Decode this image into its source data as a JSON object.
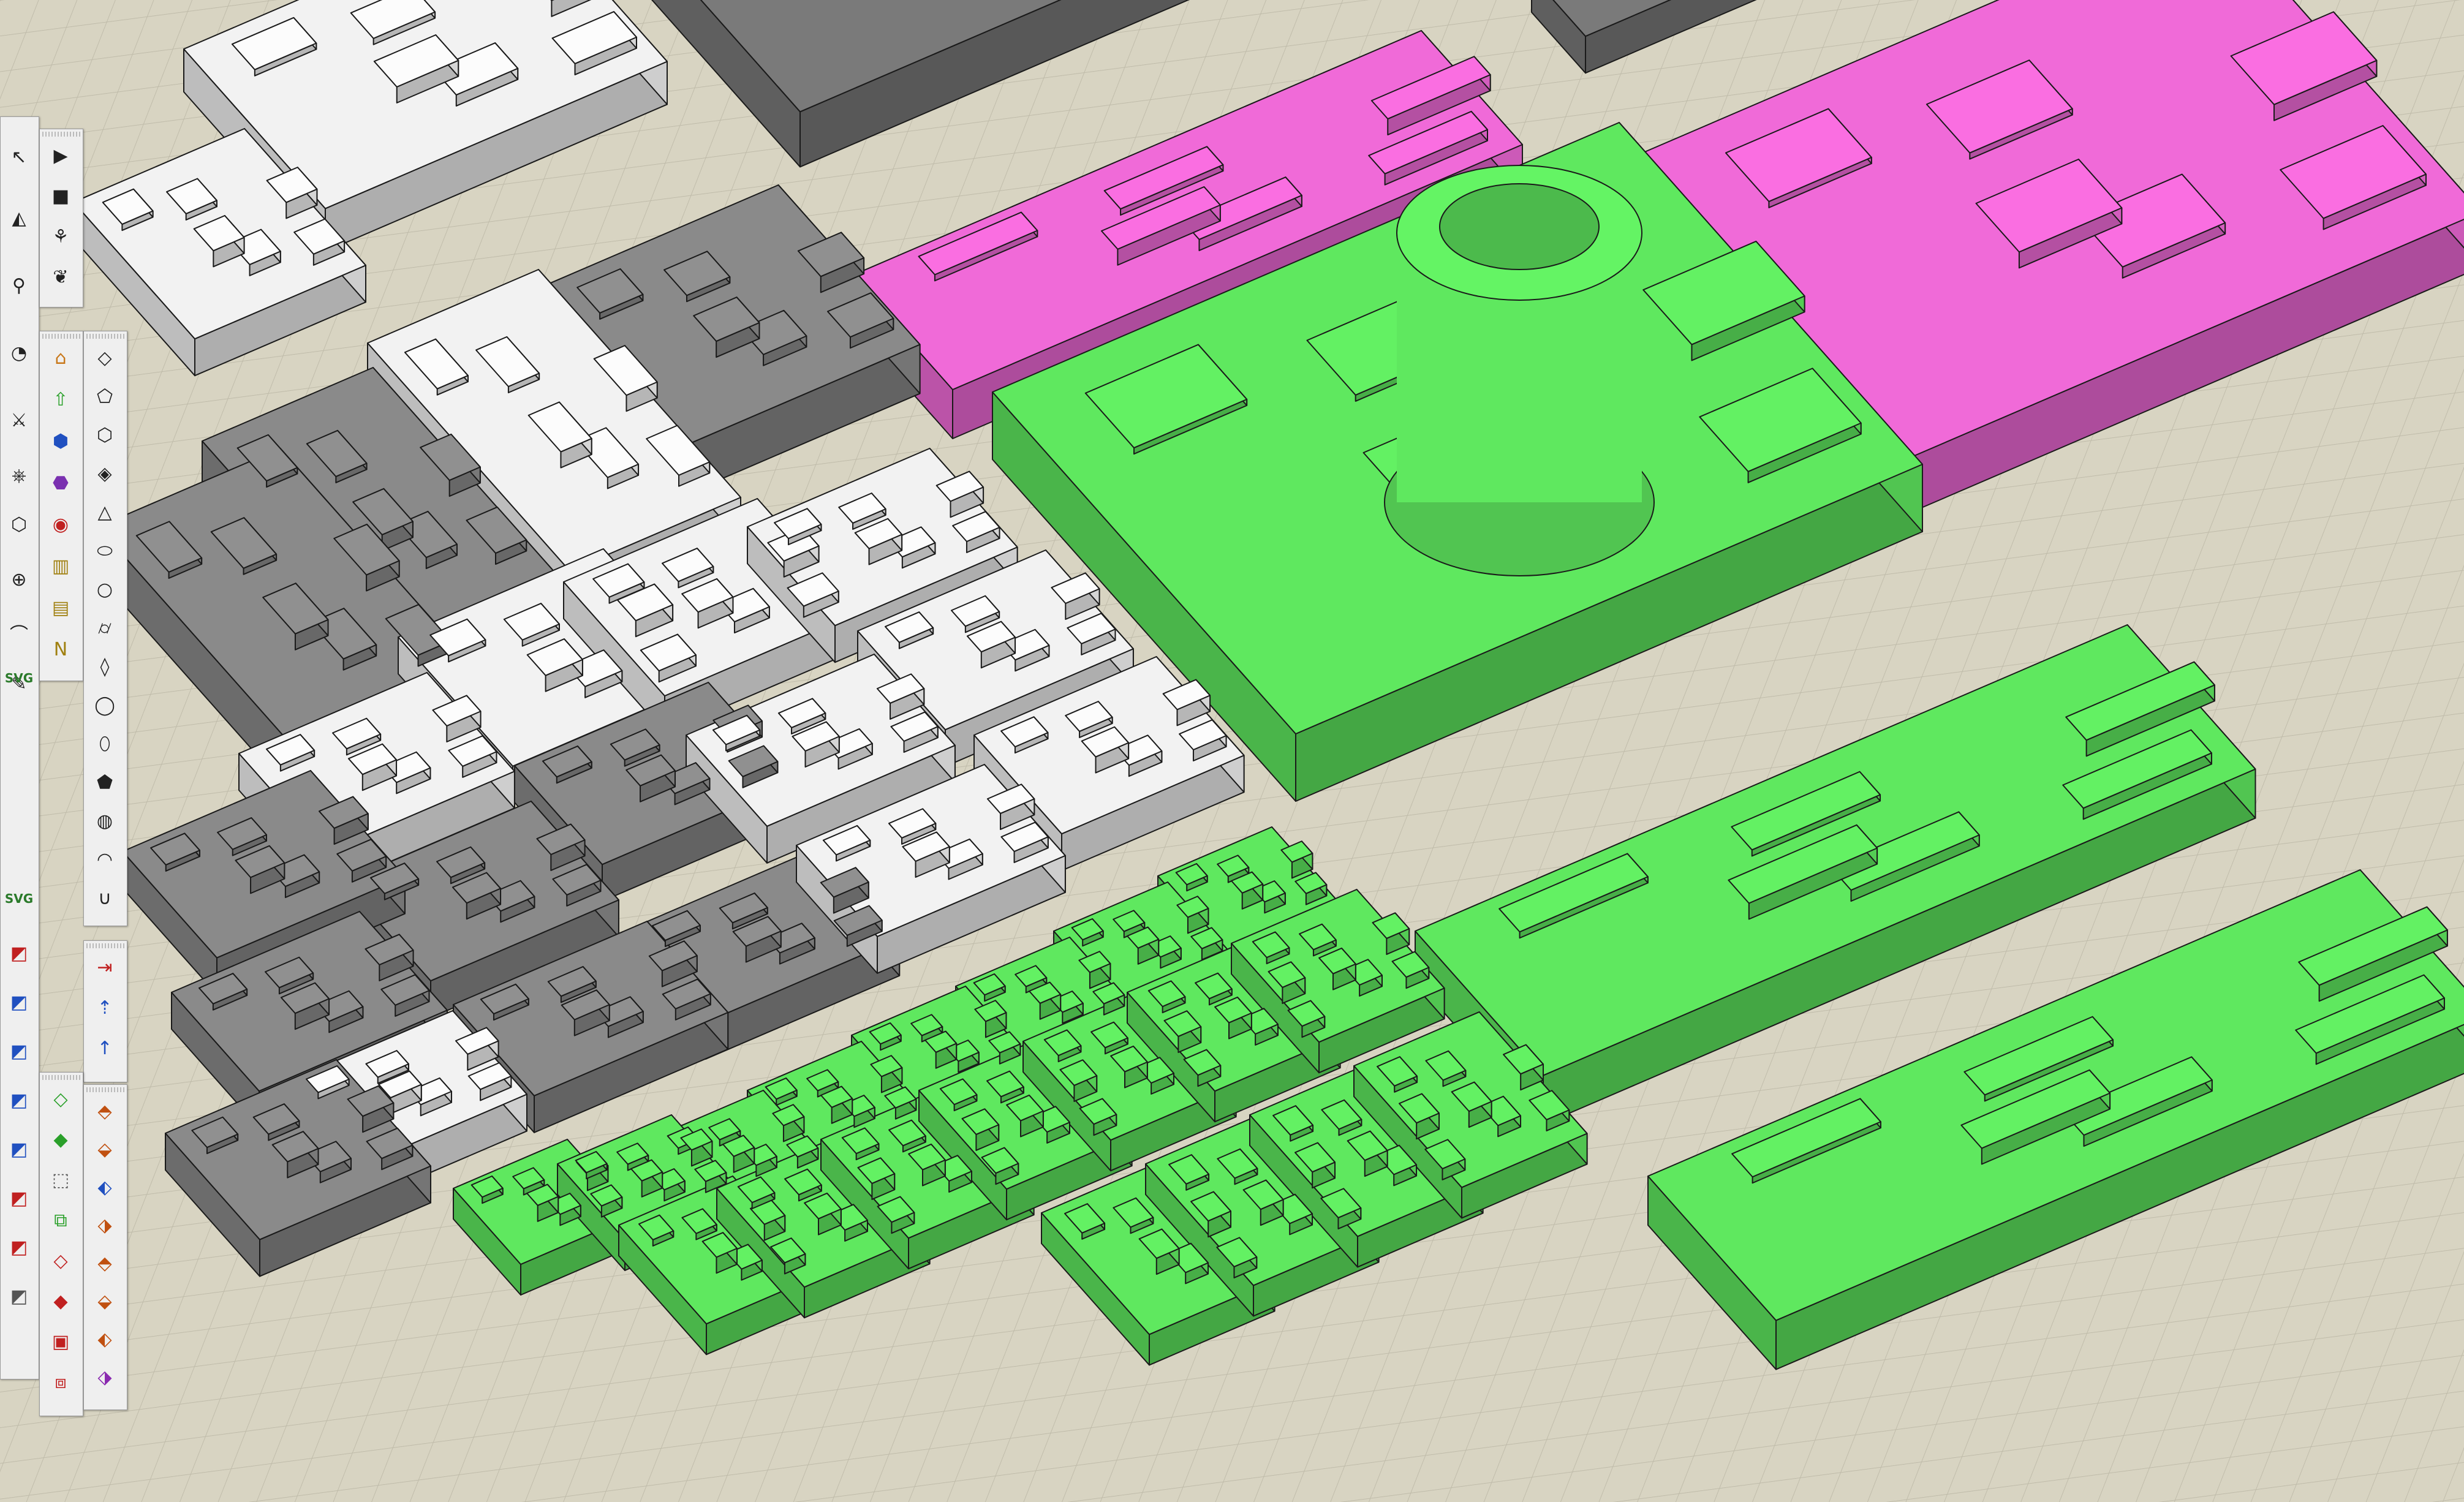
{
  "window": {
    "app": "3D modeling application"
  },
  "scene": {
    "groups": [
      "white-tiles",
      "gray-tiles",
      "green-tiles",
      "magenta-tiles"
    ],
    "colors": {
      "ground": "#d8d4c2",
      "grid": "#bfbba9",
      "white_tile": "#f2f2f2",
      "gray_tile": "#8a8a8a",
      "green_tile": "#5fe85f",
      "magenta_tile": "#f06ad8",
      "edge": "#1a1a1a"
    }
  },
  "toolbar_left": {
    "title": "Toolbar",
    "tools": [
      {
        "icon": "play-icon",
        "glyph": "▶"
      },
      {
        "icon": "stop-icon",
        "glyph": "■"
      },
      {
        "icon": "bird-icon",
        "glyph": "⚘"
      },
      {
        "icon": "bird-outline-icon",
        "glyph": "❦"
      },
      {
        "icon": "select-arrow-icon",
        "glyph": "↖"
      },
      {
        "icon": "pyramid-icon",
        "glyph": "◭"
      },
      {
        "icon": "pin-icon",
        "glyph": "⚲"
      },
      {
        "icon": "gauge-icon",
        "glyph": "◔"
      },
      {
        "icon": "sword-icon",
        "glyph": "⚔"
      },
      {
        "icon": "wheel-icon",
        "glyph": "⎈"
      },
      {
        "icon": "shield-icon",
        "glyph": "⬡"
      },
      {
        "icon": "crosshair-icon",
        "glyph": "⊕"
      },
      {
        "icon": "curve-icon",
        "glyph": "⌒"
      },
      {
        "icon": "paint-icon",
        "glyph": "✎"
      }
    ],
    "svg_label": "SVG",
    "svg_label_2": "SVG"
  },
  "toolbar_shapes": {
    "tools": [
      {
        "icon": "house-icon",
        "glyph": "⌂"
      },
      {
        "icon": "arrow-up-icon",
        "glyph": "⇧"
      },
      {
        "icon": "cube-icon",
        "glyph": "⬢"
      },
      {
        "icon": "hexagon-icon",
        "glyph": "⬣"
      },
      {
        "icon": "spiral-icon",
        "glyph": "◉"
      },
      {
        "icon": "chart-icon",
        "glyph": "▥"
      },
      {
        "icon": "align-icon",
        "glyph": "▤"
      },
      {
        "icon": "ne-icon",
        "glyph": "N"
      }
    ]
  },
  "toolbar_outlines": {
    "tools": [
      {
        "icon": "shape-1-icon",
        "glyph": "◇"
      },
      {
        "icon": "shape-2-icon",
        "glyph": "⬠"
      },
      {
        "icon": "shape-3-icon",
        "glyph": "⬡"
      },
      {
        "icon": "shape-4-icon",
        "glyph": "◈"
      },
      {
        "icon": "shape-5-icon",
        "glyph": "△"
      },
      {
        "icon": "shape-6-icon",
        "glyph": "⬭"
      },
      {
        "icon": "circle-icon",
        "glyph": "○"
      },
      {
        "icon": "cylinder-icon",
        "glyph": "⌭"
      },
      {
        "icon": "drop-icon",
        "glyph": "◊"
      },
      {
        "icon": "ring-icon",
        "glyph": "◯"
      },
      {
        "icon": "lens-icon",
        "glyph": "⬯"
      },
      {
        "icon": "polygon-icon",
        "glyph": "⬟"
      },
      {
        "icon": "sphere-icon",
        "glyph": "◍"
      },
      {
        "icon": "dome-icon",
        "glyph": "◠"
      },
      {
        "icon": "magnet-icon",
        "glyph": "∪"
      }
    ]
  },
  "toolbar_transform": {
    "tools": [
      {
        "icon": "move-x-icon",
        "glyph": "⇥"
      },
      {
        "icon": "move-y-icon",
        "glyph": "⇡"
      },
      {
        "icon": "move-z-icon",
        "glyph": "↑"
      }
    ]
  },
  "toolbar_solids": {
    "tools": [
      {
        "icon": "face-icon",
        "glyph": "◇"
      },
      {
        "icon": "face-filled-icon",
        "glyph": "◆"
      },
      {
        "icon": "box-icon",
        "glyph": "⬚"
      },
      {
        "icon": "box-stack-icon",
        "glyph": "⧉"
      },
      {
        "icon": "diamond-red-icon",
        "glyph": "◇"
      },
      {
        "icon": "diamond-fill-icon",
        "glyph": "◆"
      },
      {
        "icon": "cube-red-icon",
        "glyph": "▣"
      },
      {
        "icon": "cube-stack-icon",
        "glyph": "⧈"
      }
    ]
  },
  "toolbar_solid_tools": {
    "tools": [
      {
        "icon": "solid-union-icon",
        "glyph": "⬘"
      },
      {
        "icon": "solid-subtract-icon",
        "glyph": "⬙"
      },
      {
        "icon": "solid-intersect-icon",
        "glyph": "⬖"
      },
      {
        "icon": "solid-trim-icon",
        "glyph": "⬗"
      },
      {
        "icon": "solid-split-icon",
        "glyph": "⬘"
      },
      {
        "icon": "solid-outer-icon",
        "glyph": "⬙"
      },
      {
        "icon": "solid-combine-icon",
        "glyph": "⬖"
      },
      {
        "icon": "solid-fill-icon",
        "glyph": "⬗"
      }
    ]
  }
}
